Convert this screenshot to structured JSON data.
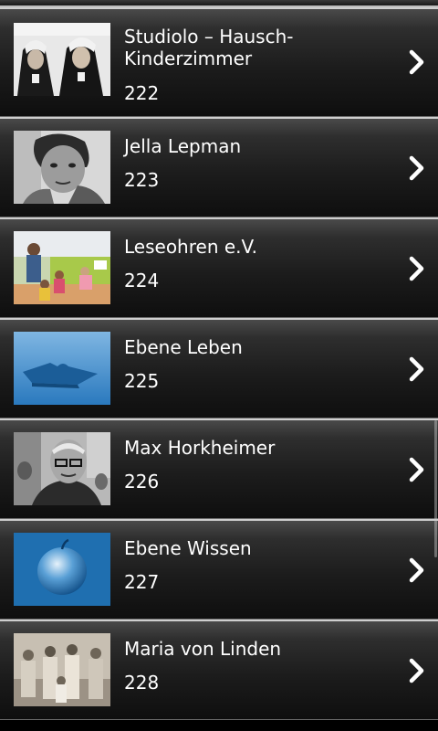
{
  "list": {
    "items": [
      {
        "title": "Studiolo – Hausch-Kinderzimmer",
        "number": "222",
        "image": "two-nuns-photo"
      },
      {
        "title": "Jella Lepman",
        "number": "223",
        "image": "woman-portrait-photo"
      },
      {
        "title": "Leseohren e.V.",
        "number": "224",
        "image": "children-reading-photo"
      },
      {
        "title": "Ebene Leben",
        "number": "225",
        "image": "blue-puzzle-photo"
      },
      {
        "title": "Max Horkheimer",
        "number": "226",
        "image": "man-glasses-photo"
      },
      {
        "title": "Ebene Wissen",
        "number": "227",
        "image": "blue-apple-photo"
      },
      {
        "title": "Maria von Linden",
        "number": "228",
        "image": "group-photo"
      }
    ],
    "chevron_icon": "chevron-right-icon"
  },
  "colors": {
    "row_border": "#cfcfcf",
    "text": "#ffffff",
    "accent_blue": "#1e6fb3"
  }
}
